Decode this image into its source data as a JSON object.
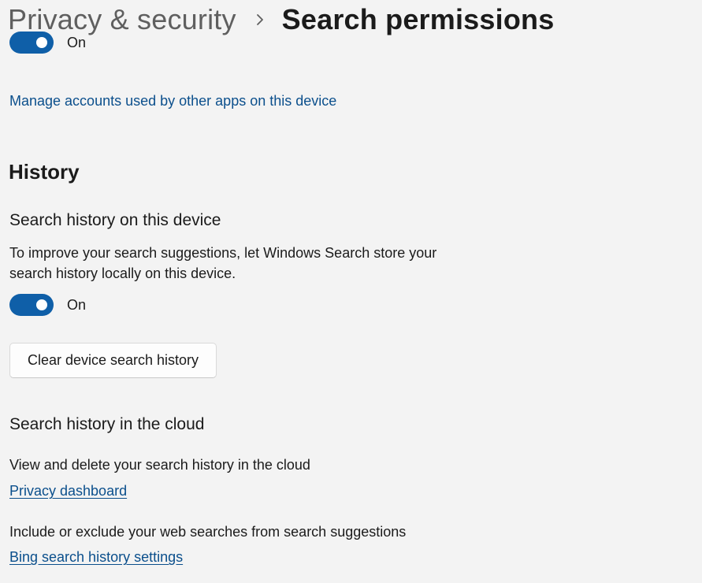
{
  "header": {
    "parent": "Privacy & security",
    "current": "Search permissions"
  },
  "top_toggle": {
    "state_label": "On",
    "on": true
  },
  "manage_accounts_link": "Manage accounts used by other apps on this device",
  "history": {
    "title": "History",
    "device": {
      "title": "Search history on this device",
      "description_line1": "To improve your search suggestions, let Windows Search store your",
      "description_line2": "search history locally on this device.",
      "toggle_label": "On",
      "toggle_on": true,
      "clear_button": "Clear device search history"
    },
    "cloud": {
      "title": "Search history in the cloud",
      "view_text": "View and delete your search history in the cloud",
      "privacy_link": "Privacy dashboard",
      "include_text": "Include or exclude your web searches from search suggestions",
      "bing_link": "Bing search history settings"
    }
  },
  "colors": {
    "accent": "#0f5fa8",
    "link": "#0b4f8c",
    "background": "#f3f3f3"
  }
}
